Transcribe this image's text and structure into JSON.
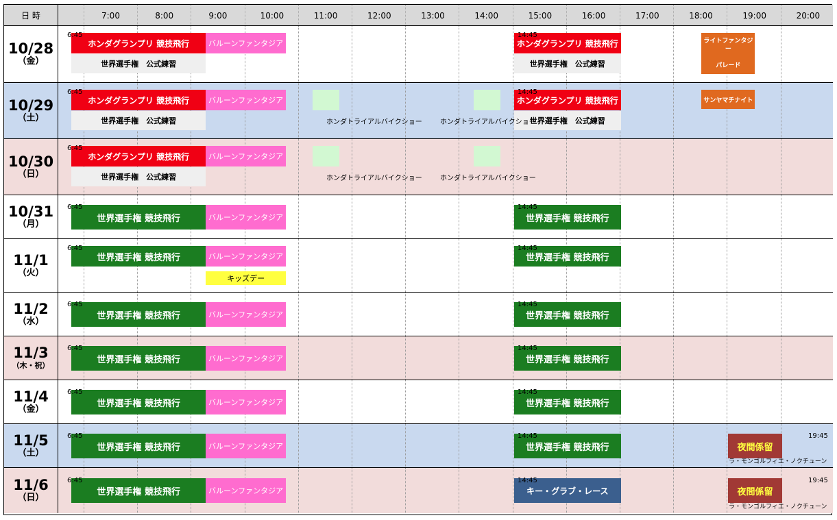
{
  "header": {
    "corner": "日 時",
    "hours": [
      "7:00",
      "8:00",
      "9:00",
      "10:00",
      "11:00",
      "12:00",
      "13:00",
      "14:00",
      "15:00",
      "16:00",
      "17:00",
      "18:00",
      "19:00",
      "20:00"
    ]
  },
  "days": [
    {
      "date": "10/28",
      "dow": "（金）",
      "bg": "#ffffff",
      "events": [
        {
          "label": "ホンダグランプリ 競技飛行",
          "start": "6:45",
          "end": "9:15",
          "style": "red",
          "pos": "top"
        },
        {
          "label": "世界選手権　公式練習",
          "start": "6:45",
          "end": "9:15",
          "style": "gray",
          "pos": "bottom"
        },
        {
          "label": "バルーンファンタジア",
          "start": "9:15",
          "end": "10:45",
          "style": "pink",
          "pos": "top"
        },
        {
          "label": "ホンダグランプリ 競技飛行",
          "start": "15:00",
          "end": "17:00",
          "style": "red",
          "pos": "top"
        },
        {
          "label": "世界選手権　公式練習",
          "start": "15:00",
          "end": "17:00",
          "style": "gray",
          "pos": "bottom"
        },
        {
          "label": "ライトファンタジー\n\nパレード",
          "start": "18:30",
          "end": "19:30",
          "style": "orange",
          "pos": "full"
        }
      ],
      "labels": [
        {
          "text": "6:45",
          "at": "left"
        },
        {
          "text": "14:45",
          "at": "pm"
        }
      ]
    },
    {
      "date": "10/29",
      "dow": "（土）",
      "bg": "#c9d9ef",
      "events": [
        {
          "label": "ホンダグランプリ 競技飛行",
          "start": "6:45",
          "end": "9:15",
          "style": "red",
          "pos": "top"
        },
        {
          "label": "世界選手権　公式練習",
          "start": "6:45",
          "end": "9:15",
          "style": "gray",
          "pos": "bottom"
        },
        {
          "label": "バルーンファンタジア",
          "start": "9:15",
          "end": "10:45",
          "style": "pink",
          "pos": "top"
        },
        {
          "label": "",
          "start": "11:15",
          "end": "11:45",
          "style": "mint",
          "pos": "top"
        },
        {
          "label": "",
          "start": "14:15",
          "end": "14:45",
          "style": "mint",
          "pos": "top"
        },
        {
          "label": "ホンダグランプリ 競技飛行",
          "start": "15:00",
          "end": "17:00",
          "style": "red",
          "pos": "top"
        },
        {
          "label": "世界選手権　公式練習",
          "start": "15:00",
          "end": "17:00",
          "style": "gray",
          "pos": "bottom"
        },
        {
          "label": "サンヤマチナイト",
          "start": "18:30",
          "end": "19:30",
          "style": "orange",
          "pos": "top"
        }
      ],
      "texts": [
        {
          "text": "ホンダトライアルバイクショー",
          "at": "trial1"
        },
        {
          "text": "ホンダトライアルバイクショー",
          "at": "trial2"
        }
      ],
      "labels": [
        {
          "text": "6:45",
          "at": "left"
        },
        {
          "text": "14:45",
          "at": "pm"
        }
      ]
    },
    {
      "date": "10/30",
      "dow": "（日）",
      "bg": "#f2dcdb",
      "events": [
        {
          "label": "ホンダグランプリ 競技飛行",
          "start": "6:45",
          "end": "9:15",
          "style": "red",
          "pos": "top"
        },
        {
          "label": "世界選手権　公式練習",
          "start": "6:45",
          "end": "9:15",
          "style": "gray",
          "pos": "bottom"
        },
        {
          "label": "バルーンファンタジア",
          "start": "9:15",
          "end": "10:45",
          "style": "pink",
          "pos": "top"
        },
        {
          "label": "",
          "start": "11:15",
          "end": "11:45",
          "style": "mint",
          "pos": "top"
        },
        {
          "label": "",
          "start": "14:15",
          "end": "14:45",
          "style": "mint",
          "pos": "top"
        }
      ],
      "texts": [
        {
          "text": "ホンダトライアルバイクショー",
          "at": "trial1"
        },
        {
          "text": "ホンダトライアルバイクショー",
          "at": "trial2"
        }
      ],
      "labels": [
        {
          "text": "6:45",
          "at": "left"
        }
      ]
    },
    {
      "date": "10/31",
      "dow": "（月）",
      "bg": "#ffffff",
      "events": [
        {
          "label": "世界選手権 競技飛行",
          "start": "6:45",
          "end": "9:15",
          "style": "green",
          "pos": "mid"
        },
        {
          "label": "バルーンファンタジア",
          "start": "9:15",
          "end": "10:45",
          "style": "pink",
          "pos": "mid"
        },
        {
          "label": "世界選手権 競技飛行",
          "start": "15:00",
          "end": "17:00",
          "style": "green",
          "pos": "mid"
        }
      ],
      "labels": [
        {
          "text": "6:45",
          "at": "left"
        },
        {
          "text": "14:45",
          "at": "pm"
        }
      ]
    },
    {
      "date": "11/1",
      "dow": "（火）",
      "bg": "#ffffff",
      "events": [
        {
          "label": "世界選手権 競技飛行",
          "start": "6:45",
          "end": "9:15",
          "style": "green",
          "pos": "top"
        },
        {
          "label": "バルーンファンタジア",
          "start": "9:15",
          "end": "10:45",
          "style": "pink",
          "pos": "top"
        },
        {
          "label": "キッズデー",
          "start": "9:15",
          "end": "10:45",
          "style": "yellow",
          "pos": "bottom"
        },
        {
          "label": "世界選手権 競技飛行",
          "start": "15:00",
          "end": "17:00",
          "style": "green",
          "pos": "top"
        }
      ],
      "labels": [
        {
          "text": "6:45",
          "at": "left"
        },
        {
          "text": "14:45",
          "at": "pm"
        }
      ]
    },
    {
      "date": "11/2",
      "dow": "（水）",
      "bg": "#ffffff",
      "events": [
        {
          "label": "世界選手権 競技飛行",
          "start": "6:45",
          "end": "9:15",
          "style": "green",
          "pos": "mid"
        },
        {
          "label": "バルーンファンタジア",
          "start": "9:15",
          "end": "10:45",
          "style": "pink",
          "pos": "mid"
        },
        {
          "label": "世界選手権 競技飛行",
          "start": "15:00",
          "end": "17:00",
          "style": "green",
          "pos": "mid"
        }
      ],
      "labels": [
        {
          "text": "6:45",
          "at": "left"
        },
        {
          "text": "14:45",
          "at": "pm"
        }
      ]
    },
    {
      "date": "11/3",
      "dow": "（木・祝）",
      "bg": "#f2dcdb",
      "events": [
        {
          "label": "世界選手権 競技飛行",
          "start": "6:45",
          "end": "9:15",
          "style": "green",
          "pos": "mid"
        },
        {
          "label": "バルーンファンタジア",
          "start": "9:15",
          "end": "10:45",
          "style": "pink",
          "pos": "mid"
        },
        {
          "label": "世界選手権 競技飛行",
          "start": "15:00",
          "end": "17:00",
          "style": "green",
          "pos": "mid"
        }
      ],
      "labels": [
        {
          "text": "6:45",
          "at": "left"
        },
        {
          "text": "14:45",
          "at": "pm"
        }
      ]
    },
    {
      "date": "11/4",
      "dow": "（金）",
      "bg": "#ffffff",
      "events": [
        {
          "label": "世界選手権 競技飛行",
          "start": "6:45",
          "end": "9:15",
          "style": "green",
          "pos": "mid"
        },
        {
          "label": "バルーンファンタジア",
          "start": "9:15",
          "end": "10:45",
          "style": "pink",
          "pos": "mid"
        },
        {
          "label": "世界選手権 競技飛行",
          "start": "15:00",
          "end": "17:00",
          "style": "green",
          "pos": "mid"
        }
      ],
      "labels": [
        {
          "text": "6:45",
          "at": "left"
        },
        {
          "text": "14:45",
          "at": "pm"
        }
      ]
    },
    {
      "date": "11/5",
      "dow": "（土）",
      "bg": "#c9d9ef",
      "events": [
        {
          "label": "世界選手権 競技飛行",
          "start": "6:45",
          "end": "9:15",
          "style": "green",
          "pos": "mid"
        },
        {
          "label": "バルーンファンタジア",
          "start": "9:15",
          "end": "10:45",
          "style": "pink",
          "pos": "mid"
        },
        {
          "label": "世界選手権 競技飛行",
          "start": "15:00",
          "end": "17:00",
          "style": "green",
          "pos": "mid"
        },
        {
          "label": "夜間係留",
          "start": "19:00",
          "end": "20:00",
          "style": "maroon",
          "pos": "mid"
        }
      ],
      "texts": [
        {
          "text": "ラ・モンゴルフィエ・ノクチューン",
          "at": "night"
        }
      ],
      "labels": [
        {
          "text": "6:45",
          "at": "left"
        },
        {
          "text": "14:45",
          "at": "pm"
        },
        {
          "text": "19:45",
          "at": "night"
        }
      ]
    },
    {
      "date": "11/6",
      "dow": "（日）",
      "bg": "#f2dcdb",
      "events": [
        {
          "label": "世界選手権 競技飛行",
          "start": "6:45",
          "end": "9:15",
          "style": "green",
          "pos": "mid"
        },
        {
          "label": "バルーンファンタジア",
          "start": "9:15",
          "end": "10:45",
          "style": "pink",
          "pos": "mid"
        },
        {
          "label": "キー・グラブ・レース",
          "start": "15:00",
          "end": "17:00",
          "style": "blue",
          "pos": "mid"
        },
        {
          "label": "夜間係留",
          "start": "19:00",
          "end": "20:00",
          "style": "maroon",
          "pos": "mid"
        }
      ],
      "texts": [
        {
          "text": "ラ・モンゴルフィエ・ノクチューン",
          "at": "night"
        }
      ],
      "labels": [
        {
          "text": "6:45",
          "at": "left"
        },
        {
          "text": "14:45",
          "at": "pm"
        },
        {
          "text": "19:45",
          "at": "night"
        }
      ]
    }
  ]
}
